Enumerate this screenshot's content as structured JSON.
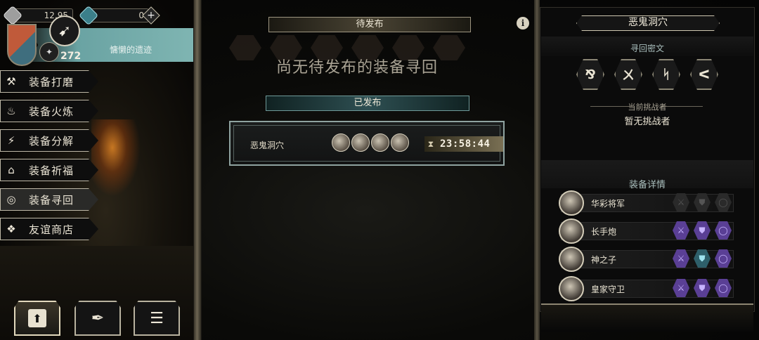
{
  "resources": {
    "gold": "12,95",
    "gems": "0"
  },
  "player": {
    "level": "272",
    "location_label": "慵懒的遗迹"
  },
  "menu": [
    {
      "label": "装备打磨",
      "icon": "hammer-icon",
      "glyph": "⚒"
    },
    {
      "label": "装备火炼",
      "icon": "flame-icon",
      "glyph": "🔥"
    },
    {
      "label": "装备分解",
      "icon": "lightning-icon",
      "glyph": "⚡"
    },
    {
      "label": "装备祈福",
      "icon": "pray-icon",
      "glyph": "⌂"
    },
    {
      "label": "装备寻回",
      "icon": "target-icon",
      "glyph": "◎"
    },
    {
      "label": "友谊商店",
      "icon": "fox-icon",
      "glyph": "🦊"
    }
  ],
  "center": {
    "pending_title": "待发布",
    "empty_message": "尚无待发布的装备寻回",
    "published_title": "已发布",
    "published_item": {
      "name": "恶鬼洞穴",
      "timer": "23:58:44"
    }
  },
  "right": {
    "title": "恶鬼洞穴",
    "runes_title": "寻回密文",
    "runes": [
      "⅋",
      "ㄨ",
      "ᛋ",
      "ᐸ"
    ],
    "challenger_label": "当前挑战者",
    "challenger_value": "暂无挑战者",
    "equip_title": "装备详情",
    "equipment": [
      {
        "name": "华彩将军",
        "slots": [
          "off",
          "off",
          "off"
        ]
      },
      {
        "name": "长手炮",
        "slots": [
          "purple",
          "purple",
          "blue"
        ]
      },
      {
        "name": "神之子",
        "slots": [
          "purple",
          "blue",
          "purple"
        ]
      },
      {
        "name": "皇家守卫",
        "slots": [
          "purple",
          "purple",
          "blue"
        ]
      }
    ]
  },
  "colors": {
    "accent_teal": "#7fb5b2",
    "slot_purple": "#5a3f95",
    "slot_blue": "#2e5f6a"
  }
}
